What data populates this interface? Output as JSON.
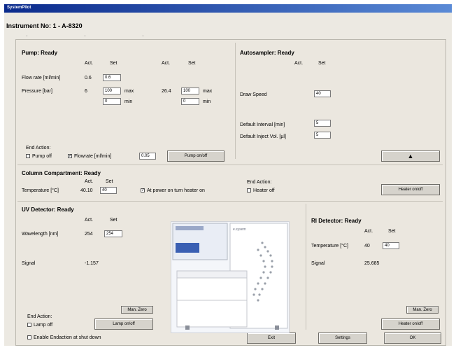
{
  "window": {
    "title": "SystemPilot"
  },
  "instrument_title": "Instrument No: 1 - A-8320",
  "tick_marks": "' ' '",
  "pump": {
    "title": "Pump: Ready",
    "col_act": "Act.",
    "col_set": "Set",
    "col_act2": "Act.",
    "col_set2": "Set",
    "flow_label": "Flow rate [ml/min]",
    "flow_act": "0.6",
    "flow_set": "0.6",
    "pressure_label": "Pressure [bar]",
    "pressure_act": "6",
    "pressure_max": "100",
    "pressure_min": "0",
    "max_label": "max",
    "min_label": "min",
    "pressure2_act": "26.4",
    "pressure2_max": "100",
    "pressure2_min": "0",
    "max2_label": "max",
    "min2_label": "min",
    "end_action_label": "End Action:",
    "pump_off_label": "Pump off",
    "flowrate_label": "Flowrate [ml/min]",
    "flowrate_value": "0.05",
    "onoff_button": "Pump on/off"
  },
  "autosampler": {
    "title": "Autosampler: Ready",
    "col_act": "Act.",
    "col_set": "Set",
    "draw_label": "Draw Speed",
    "draw_set": "40",
    "interval_label": "Default Interval [min]",
    "interval_set": "5",
    "inject_label": "Default Inject Vol. [µl]",
    "inject_set": "5",
    "eject_button": "▲"
  },
  "column": {
    "title": "Column Compartment: Ready",
    "col_act": "Act.",
    "col_set": "Set",
    "temp_label": "Temperature [°C]",
    "temp_act": "40.10",
    "temp_set": "40",
    "power_label": "At power on turn heater on",
    "end_action_label": "End Action:",
    "heater_off_label": "Heater off",
    "heater_button": "Heater on/off"
  },
  "uv": {
    "title": "UV Detector: Ready",
    "col_act": "Act.",
    "col_set": "Set",
    "wl_label": "Wavelength [nm]",
    "wl_act": "254",
    "wl_set": "254",
    "signal_label": "Signal",
    "signal_value": "-1.157",
    "autozero_button": "Man. Zero",
    "end_action_label": "End Action:",
    "lamp_off_label": "Lamp off",
    "lamp_button": "Lamp on/off"
  },
  "ri": {
    "title": "RI Detector: Ready",
    "col_act": "Act.",
    "col_set": "Set",
    "temp_label": "Temperature [°C]",
    "temp_act": "40",
    "temp_set": "40",
    "signal_label": "Signal",
    "signal_value": "25.685",
    "autozero_button": "Man. Zero",
    "heater_button": "Heater on/off"
  },
  "image": {
    "brand_text": "e.sysem"
  },
  "footer": {
    "shutdown_label": "Enable Endaction at shut down",
    "exit_button": "Exit",
    "settings_button": "Settings",
    "ok_button": "OK"
  }
}
